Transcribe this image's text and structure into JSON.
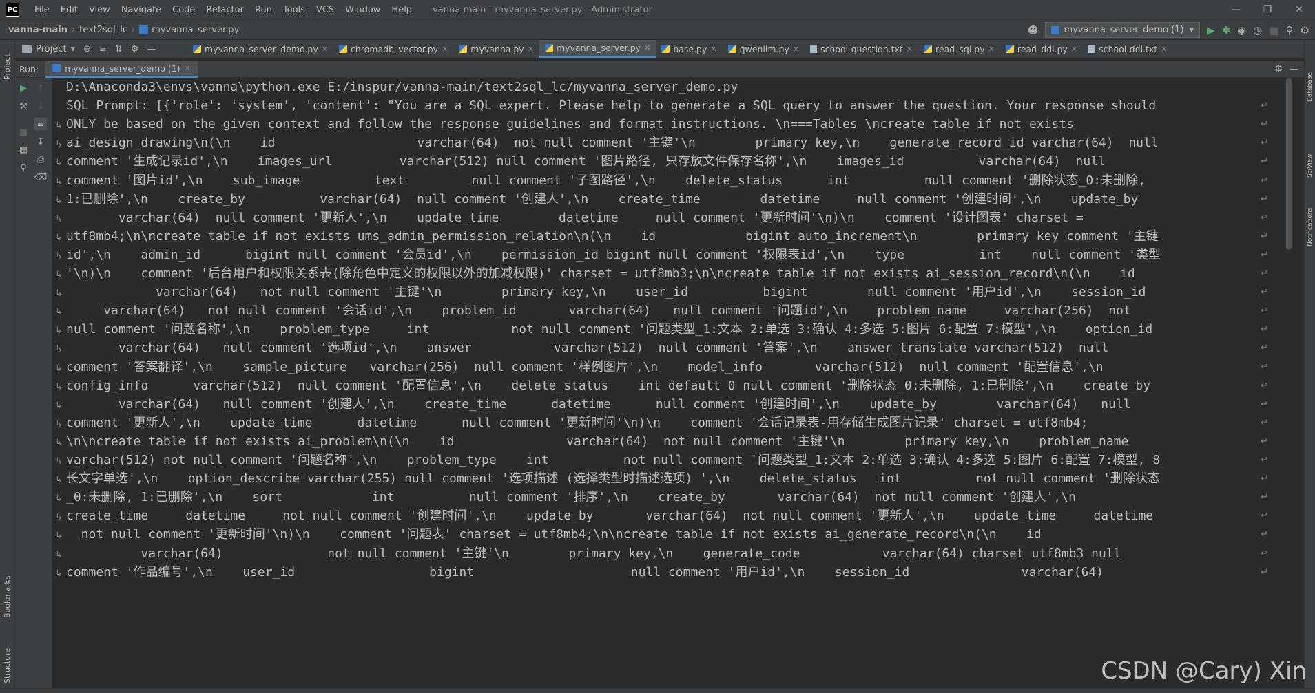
{
  "app": {
    "logo": "PC",
    "menu": [
      "File",
      "Edit",
      "View",
      "Navigate",
      "Code",
      "Refactor",
      "Run",
      "Tools",
      "VCS",
      "Window",
      "Help"
    ],
    "window_title": "vanna-main - myvanna_server.py - Administrator"
  },
  "breadcrumb": {
    "project": "vanna-main",
    "folder": "text2sql_lc",
    "file": "myvanna_server.py"
  },
  "run_config": {
    "label": "myvanna_server_demo (1)"
  },
  "project_pane": {
    "label": "Project"
  },
  "tabs": [
    {
      "label": "myvanna_server_demo.py",
      "type": "py",
      "active": false
    },
    {
      "label": "chromadb_vector.py",
      "type": "py",
      "active": false
    },
    {
      "label": "myvanna.py",
      "type": "py",
      "active": false
    },
    {
      "label": "myvanna_server.py",
      "type": "py",
      "active": true
    },
    {
      "label": "base.py",
      "type": "py",
      "active": false
    },
    {
      "label": "qwenllm.py",
      "type": "py",
      "active": false
    },
    {
      "label": "school-question.txt",
      "type": "txt",
      "active": false
    },
    {
      "label": "read_sql.py",
      "type": "py",
      "active": false
    },
    {
      "label": "read_ddl.py",
      "type": "py",
      "active": false
    },
    {
      "label": "school-ddl.txt",
      "type": "txt",
      "active": false
    }
  ],
  "run_panel": {
    "label": "Run:",
    "tab": "myvanna_server_demo (1)"
  },
  "left_stripe": {
    "project": "Project",
    "bookmarks": "Bookmarks",
    "structure": "Structure"
  },
  "right_stripe": {
    "database": "Database",
    "scview": "SciView",
    "notifications": "Notifications"
  },
  "console": {
    "lines": [
      "D:\\Anaconda3\\envs\\vanna\\python.exe E:/inspur/vanna-main/text2sql_lc/myvanna_server_demo.py",
      "SQL Prompt: [{'role': 'system', 'content': \"You are a SQL expert. Please help to generate a SQL query to answer the question. Your response should",
      "ONLY be based on the given context and follow the response guidelines and format instructions. \\n===Tables \\ncreate table if not exists",
      "ai_design_drawing\\n(\\n    id                   varchar(64)  not null comment '主键'\\n        primary key,\\n    generate_record_id varchar(64)  null",
      "comment '生成记录id',\\n    images_url         varchar(512) null comment '图片路径, 只存放文件保存名称',\\n    images_id          varchar(64)  null",
      "comment '图片id',\\n    sub_image          text         null comment '子图路径',\\n    delete_status      int          null comment '删除状态_0:未删除,",
      "1:已删除',\\n    create_by          varchar(64)  null comment '创建人',\\n    create_time        datetime     null comment '创建时间',\\n    update_by",
      "       varchar(64)  null comment '更新人',\\n    update_time        datetime     null comment '更新时间'\\n)\\n    comment '设计图表' charset =",
      "utf8mb4;\\n\\ncreate table if not exists ums_admin_permission_relation\\n(\\n    id            bigint auto_increment\\n        primary key comment '主键",
      "id',\\n    admin_id      bigint null comment '会员id',\\n    permission_id bigint null comment '权限表id',\\n    type          int    null comment '类型",
      "'\\n)\\n    comment '后台用户和权限关系表(除角色中定义的权限以外的加减权限)' charset = utf8mb3;\\n\\ncreate table if not exists ai_session_record\\n(\\n    id",
      "            varchar(64)   not null comment '主键'\\n        primary key,\\n    user_id          bigint        null comment '用户id',\\n    session_id",
      "     varchar(64)   not null comment '会话id',\\n    problem_id       varchar(64)   null comment '问题id',\\n    problem_name     varchar(256)  not",
      "null comment '问题名称',\\n    problem_type     int           not null comment '问题类型_1:文本 2:单选 3:确认 4:多选 5:图片 6:配置 7:模型',\\n    option_id",
      "       varchar(64)   null comment '选项id',\\n    answer           varchar(512)  null comment '答案',\\n    answer_translate varchar(512)  null",
      "comment '答案翻译',\\n    sample_picture   varchar(256)  null comment '样例图片',\\n    model_info       varchar(512)  null comment '配置信息',\\n",
      "config_info      varchar(512)  null comment '配置信息',\\n    delete_status    int default 0 null comment '删除状态_0:未删除, 1:已删除',\\n    create_by",
      "       varchar(64)   null comment '创建人',\\n    create_time      datetime      null comment '创建时间',\\n    update_by        varchar(64)   null",
      "comment '更新人',\\n    update_time      datetime      null comment '更新时间'\\n)\\n    comment '会话记录表-用存储生成图片记录' charset = utf8mb4;",
      "\\n\\ncreate table if not exists ai_problem\\n(\\n    id               varchar(64)  not null comment '主键'\\n        primary key,\\n    problem_name",
      "varchar(512) not null comment '问题名称',\\n    problem_type    int          not null comment '问题类型_1:文本 2:单选 3:确认 4:多选 5:图片 6:配置 7:模型, 8",
      "长文字单选',\\n    option_describe varchar(255) null comment '选项描述 (选择类型时描述选项) ',\\n    delete_status   int          not null comment '删除状态",
      "_0:未删除, 1:已删除',\\n    sort            int          null comment '排序',\\n    create_by       varchar(64)  not null comment '创建人',\\n",
      "create_time     datetime     not null comment '创建时间',\\n    update_by       varchar(64)  not null comment '更新人',\\n    update_time     datetime",
      "  not null comment '更新时间'\\n)\\n    comment '问题表' charset = utf8mb4;\\n\\ncreate table if not exists ai_generate_record\\n(\\n    id",
      "          varchar(64)              not null comment '主键'\\n        primary key,\\n    generate_code           varchar(64) charset utf8mb3 null",
      "comment '作品编号',\\n    user_id                  bigint                     null comment '用户id',\\n    session_id               varchar(64)"
    ]
  },
  "watermark": "CSDN @Cary)  Xin",
  "colors": {
    "editor_bg": "#2b2b2b",
    "panel_bg": "#3c3f41",
    "text": "#bbbbbb",
    "accent": "#4a88c7",
    "run_green": "#59a869"
  }
}
